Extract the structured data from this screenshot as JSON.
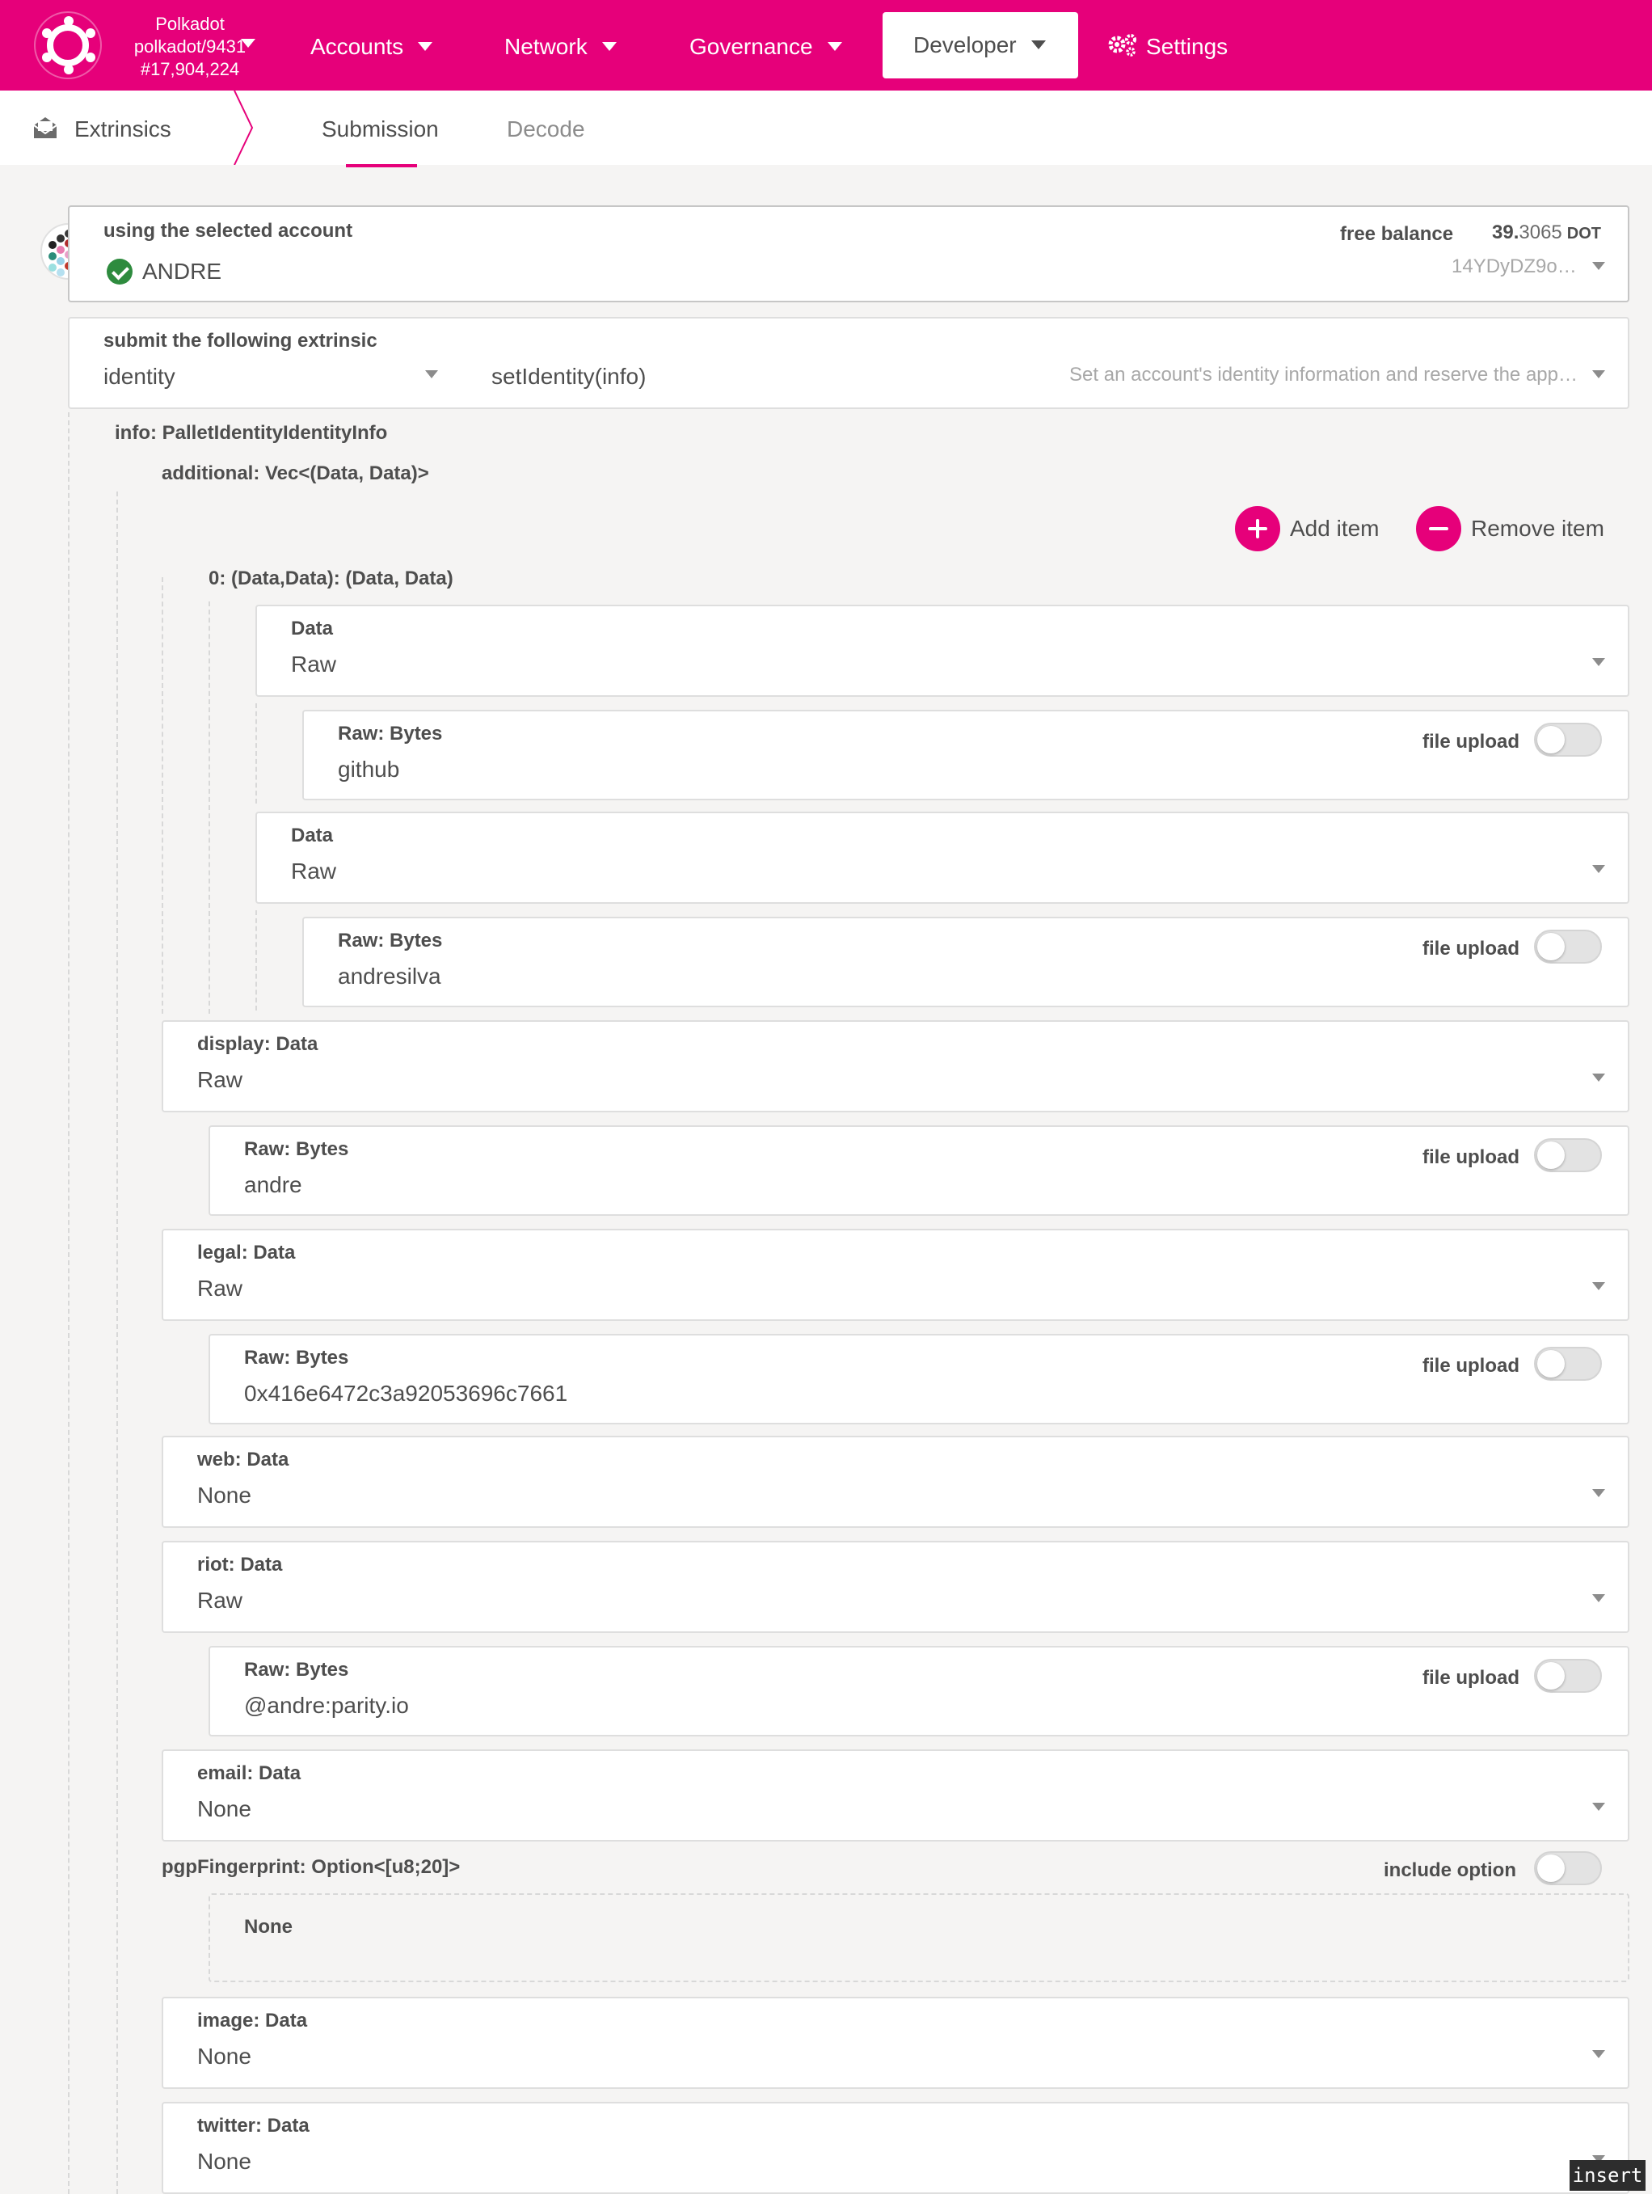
{
  "topnav": {
    "chain_name": "Polkadot",
    "chain_version": "polkadot/9431",
    "block_number": "#17,904,224",
    "menu": [
      {
        "label": "Accounts"
      },
      {
        "label": "Network"
      },
      {
        "label": "Governance"
      },
      {
        "label": "Developer"
      },
      {
        "label": "Settings"
      }
    ],
    "active_menu": "Developer"
  },
  "subnav": {
    "section": "Extrinsics",
    "tabs": [
      {
        "label": "Submission"
      },
      {
        "label": "Decode"
      }
    ],
    "active_tab": "Submission"
  },
  "account": {
    "label": "using the selected account",
    "name": "ANDRE",
    "balance_label": "free balance",
    "balance_int": "39.",
    "balance_dec": "3065",
    "balance_unit": "DOT",
    "address": "14YDyDZ9o…"
  },
  "extrinsic": {
    "label": "submit the following extrinsic",
    "pallet": "identity",
    "call": "setIdentity(info)",
    "description": "Set an account's identity information and reserve the app…"
  },
  "params": {
    "info_label": "info: PalletIdentityIdentityInfo",
    "additional_label": "additional: Vec<(Data, Data)>",
    "add_item": "Add item",
    "remove_item": "Remove item",
    "tuple_label": "0: (Data,Data): (Data, Data)",
    "data_label": "Data",
    "raw_bytes_label": "Raw: Bytes",
    "file_upload": "file upload",
    "raw": "Raw",
    "none": "None",
    "tuple_first_value": "github",
    "tuple_second_value": "andresilva",
    "display_label": "display: Data",
    "display_value": "andre",
    "legal_label": "legal: Data",
    "legal_value": "0x416e6472c3a92053696c7661",
    "web_label": "web: Data",
    "riot_label": "riot: Data",
    "riot_value": "@andre:parity.io",
    "email_label": "email: Data",
    "pgp_label": "pgpFingerprint: Option<[u8;20]>",
    "include_option": "include option",
    "image_label": "image: Data",
    "twitter_label": "twitter: Data"
  },
  "status": {
    "insert_mode": "insert"
  },
  "colors": {
    "brand": "#e6007a",
    "success": "#2e8b3e"
  }
}
